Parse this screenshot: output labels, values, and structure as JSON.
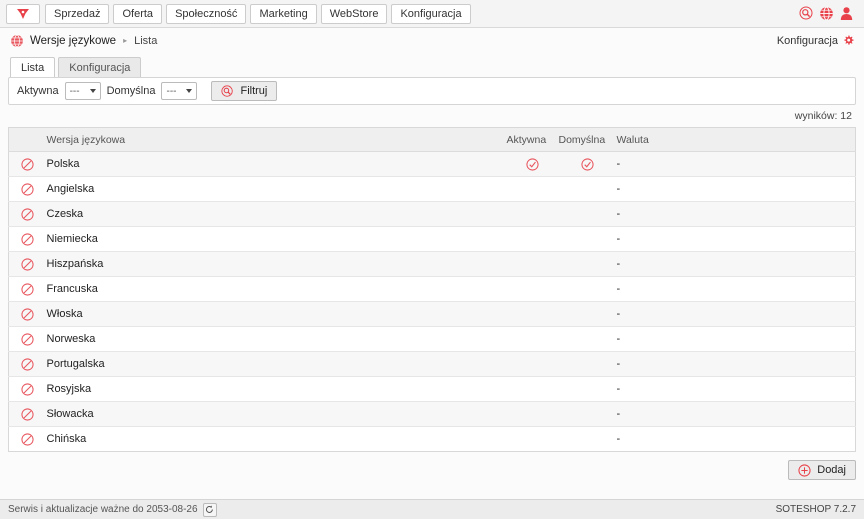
{
  "theme": {
    "accent": "#e8414a",
    "page_bg": "#fbfbfb",
    "panel_bg": "#ffffff",
    "row_alt_bg": "#f7f7f7",
    "header_bg": "#efefef"
  },
  "topbar": {
    "logo_icon": "sote-logo-icon",
    "items": [
      {
        "label": "Sprzedaż"
      },
      {
        "label": "Oferta"
      },
      {
        "label": "Społeczność"
      },
      {
        "label": "Marketing"
      },
      {
        "label": "WebStore"
      },
      {
        "label": "Konfiguracja"
      }
    ],
    "icons": [
      {
        "name": "search-icon"
      },
      {
        "name": "globe-icon"
      },
      {
        "name": "user-icon"
      }
    ]
  },
  "breadcrumb": {
    "icon": "globe-icon",
    "title": "Wersje językowe",
    "separator": "▸",
    "current": "Lista",
    "config_label": "Konfiguracja",
    "config_icon": "gear-icon"
  },
  "tabs": [
    {
      "label": "Lista",
      "active": true
    },
    {
      "label": "Konfiguracja",
      "active": false
    }
  ],
  "filterbar": {
    "active_label": "Aktywna",
    "active_value": "---",
    "default_label": "Domyślna",
    "default_value": "---",
    "filter_button": "Filtruj",
    "filter_icon": "search-icon"
  },
  "results": {
    "text": "wyników: 12"
  },
  "table": {
    "columns": {
      "icon": "",
      "name": "Wersja językowa",
      "active": "Aktywna",
      "default": "Domyślna",
      "currency": "Waluta"
    },
    "rows": [
      {
        "icon": "disabled-icon",
        "name": "Polska",
        "active": true,
        "default": true,
        "currency": "-"
      },
      {
        "icon": "disabled-icon",
        "name": "Angielska",
        "active": false,
        "default": false,
        "currency": "-"
      },
      {
        "icon": "disabled-icon",
        "name": "Czeska",
        "active": false,
        "default": false,
        "currency": "-"
      },
      {
        "icon": "disabled-icon",
        "name": "Niemiecka",
        "active": false,
        "default": false,
        "currency": "-"
      },
      {
        "icon": "disabled-icon",
        "name": "Hiszpańska",
        "active": false,
        "default": false,
        "currency": "-"
      },
      {
        "icon": "disabled-icon",
        "name": "Francuska",
        "active": false,
        "default": false,
        "currency": "-"
      },
      {
        "icon": "disabled-icon",
        "name": "Włoska",
        "active": false,
        "default": false,
        "currency": "-"
      },
      {
        "icon": "disabled-icon",
        "name": "Norweska",
        "active": false,
        "default": false,
        "currency": "-"
      },
      {
        "icon": "disabled-icon",
        "name": "Portugalska",
        "active": false,
        "default": false,
        "currency": "-"
      },
      {
        "icon": "disabled-icon",
        "name": "Rosyjska",
        "active": false,
        "default": false,
        "currency": "-"
      },
      {
        "icon": "disabled-icon",
        "name": "Słowacka",
        "active": false,
        "default": false,
        "currency": "-"
      },
      {
        "icon": "disabled-icon",
        "name": "Chińska",
        "active": false,
        "default": false,
        "currency": "-"
      }
    ]
  },
  "actions": {
    "add_label": "Dodaj",
    "add_icon": "plus-circle-icon"
  },
  "footer": {
    "service_text": "Serwis i aktualizacje ważne do 2053-08-26",
    "refresh_icon": "refresh-icon",
    "version": "SOTESHOP 7.2.7"
  }
}
